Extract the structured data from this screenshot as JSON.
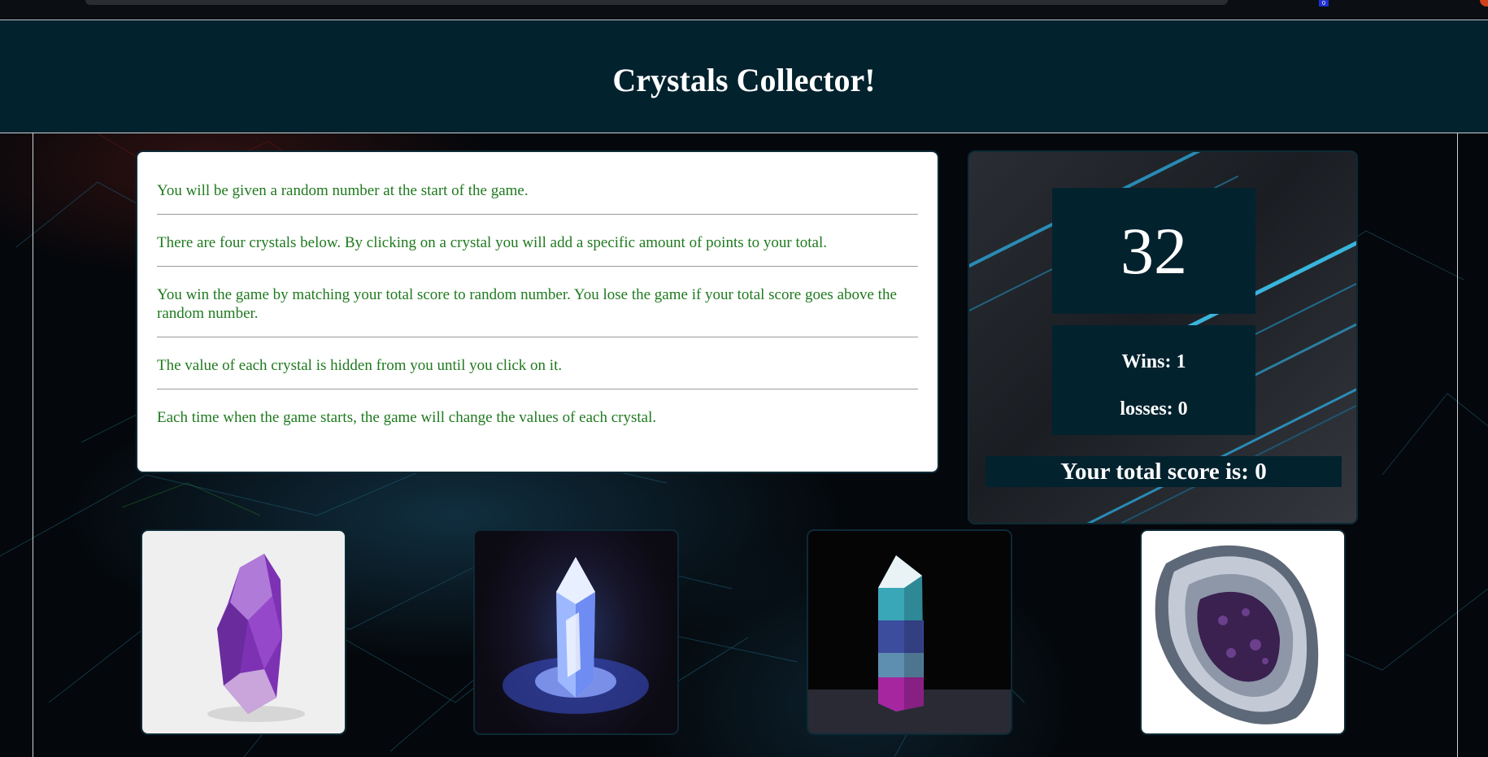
{
  "header": {
    "title": "Crystals Collector!"
  },
  "browser": {
    "extension_badge": "0"
  },
  "instructions": [
    "You will be given a random number at the start of the game.",
    "There are four crystals below. By clicking on a crystal you will add a specific amount of points to your total.",
    "You win the game by matching your total score to random number. You lose the game if your total score goes above the random number.",
    "The value of each crystal is hidden from you until you click on it.",
    "Each time when the game starts, the game will change the values of each crystal."
  ],
  "scoreboard": {
    "target_number": "32",
    "wins_text": "Wins: 1",
    "losses_text": "losses: 0",
    "total_score_text": "Your total score is: 0"
  },
  "crystals": [
    {
      "name": "purple-amethyst-point",
      "colors": [
        "#8a3fc0",
        "#c79be0"
      ]
    },
    {
      "name": "glowing-quartz-crystal",
      "colors": [
        "#7ea8ff",
        "#2b3bbf"
      ]
    },
    {
      "name": "fluorite-tower",
      "colors": [
        "#3bb8c4",
        "#9b2fa8"
      ]
    },
    {
      "name": "amethyst-geode-slice",
      "colors": [
        "#3a2150",
        "#8c97aa"
      ]
    }
  ],
  "colors": {
    "header_bg": "#02222e",
    "panel_bg": "#02222e",
    "instruction_text": "#1f7a1f"
  }
}
